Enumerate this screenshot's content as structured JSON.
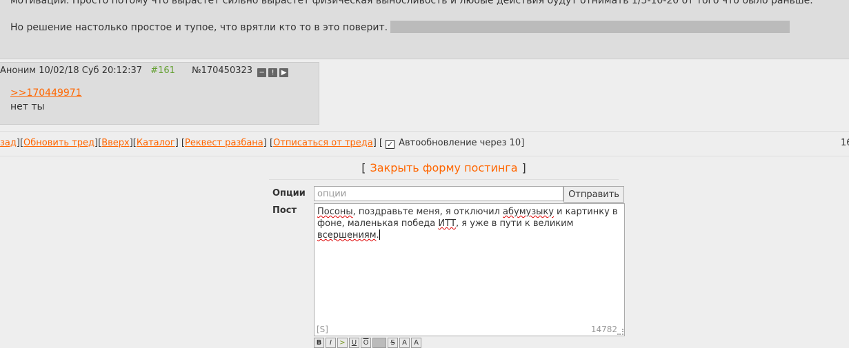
{
  "op_post": {
    "line1": "мотивации. Просто потому что вырастет сильно вырастет физическая выносливость и любые действия будут отнимать 1/5-10-20 от того что было раньше.",
    "line2": "Но решение настолько простое и тупое, что врятли кто то в это поверит."
  },
  "reply": {
    "author": "Аноним",
    "datetime": "10/02/18 Суб 20:12:37",
    "number": "#161",
    "post_id": "№170450323",
    "ref": ">>170449971",
    "text": "нет ты",
    "icons": {
      "hide": "−",
      "report": "!",
      "play": "▶"
    }
  },
  "nav": {
    "back": "зад",
    "refresh": "Обновить тред",
    "up": "Вверх",
    "catalog": "Каталог",
    "unban": "Реквест разбана",
    "unsubscribe": "Отписаться от треда",
    "autoupdate": "Автообновление через 10",
    "count": "16"
  },
  "form": {
    "close_label": "Закрыть форму постинга",
    "options_label": "Опции",
    "options_placeholder": "опции",
    "submit_label": "Отправить",
    "post_label": "Пост",
    "post_text": {
      "p1": "Посоны",
      "p2": ", поздравьте меня, я отключил ",
      "p3": "абумузыку",
      "p4": " и картинку в фоне, маленькая победа ",
      "p5": "ИТТ",
      "p6": ", я уже в пути к великим ",
      "p7": "всершениям",
      "p8": "."
    },
    "spoiler_tag": "[S]",
    "char_count": "14782"
  },
  "toolbar": {
    "bold": "B",
    "italic": "I",
    "quote": ">",
    "underline": "U",
    "overline": "O",
    "strike": "S",
    "sup": "A",
    "sub": "A"
  }
}
